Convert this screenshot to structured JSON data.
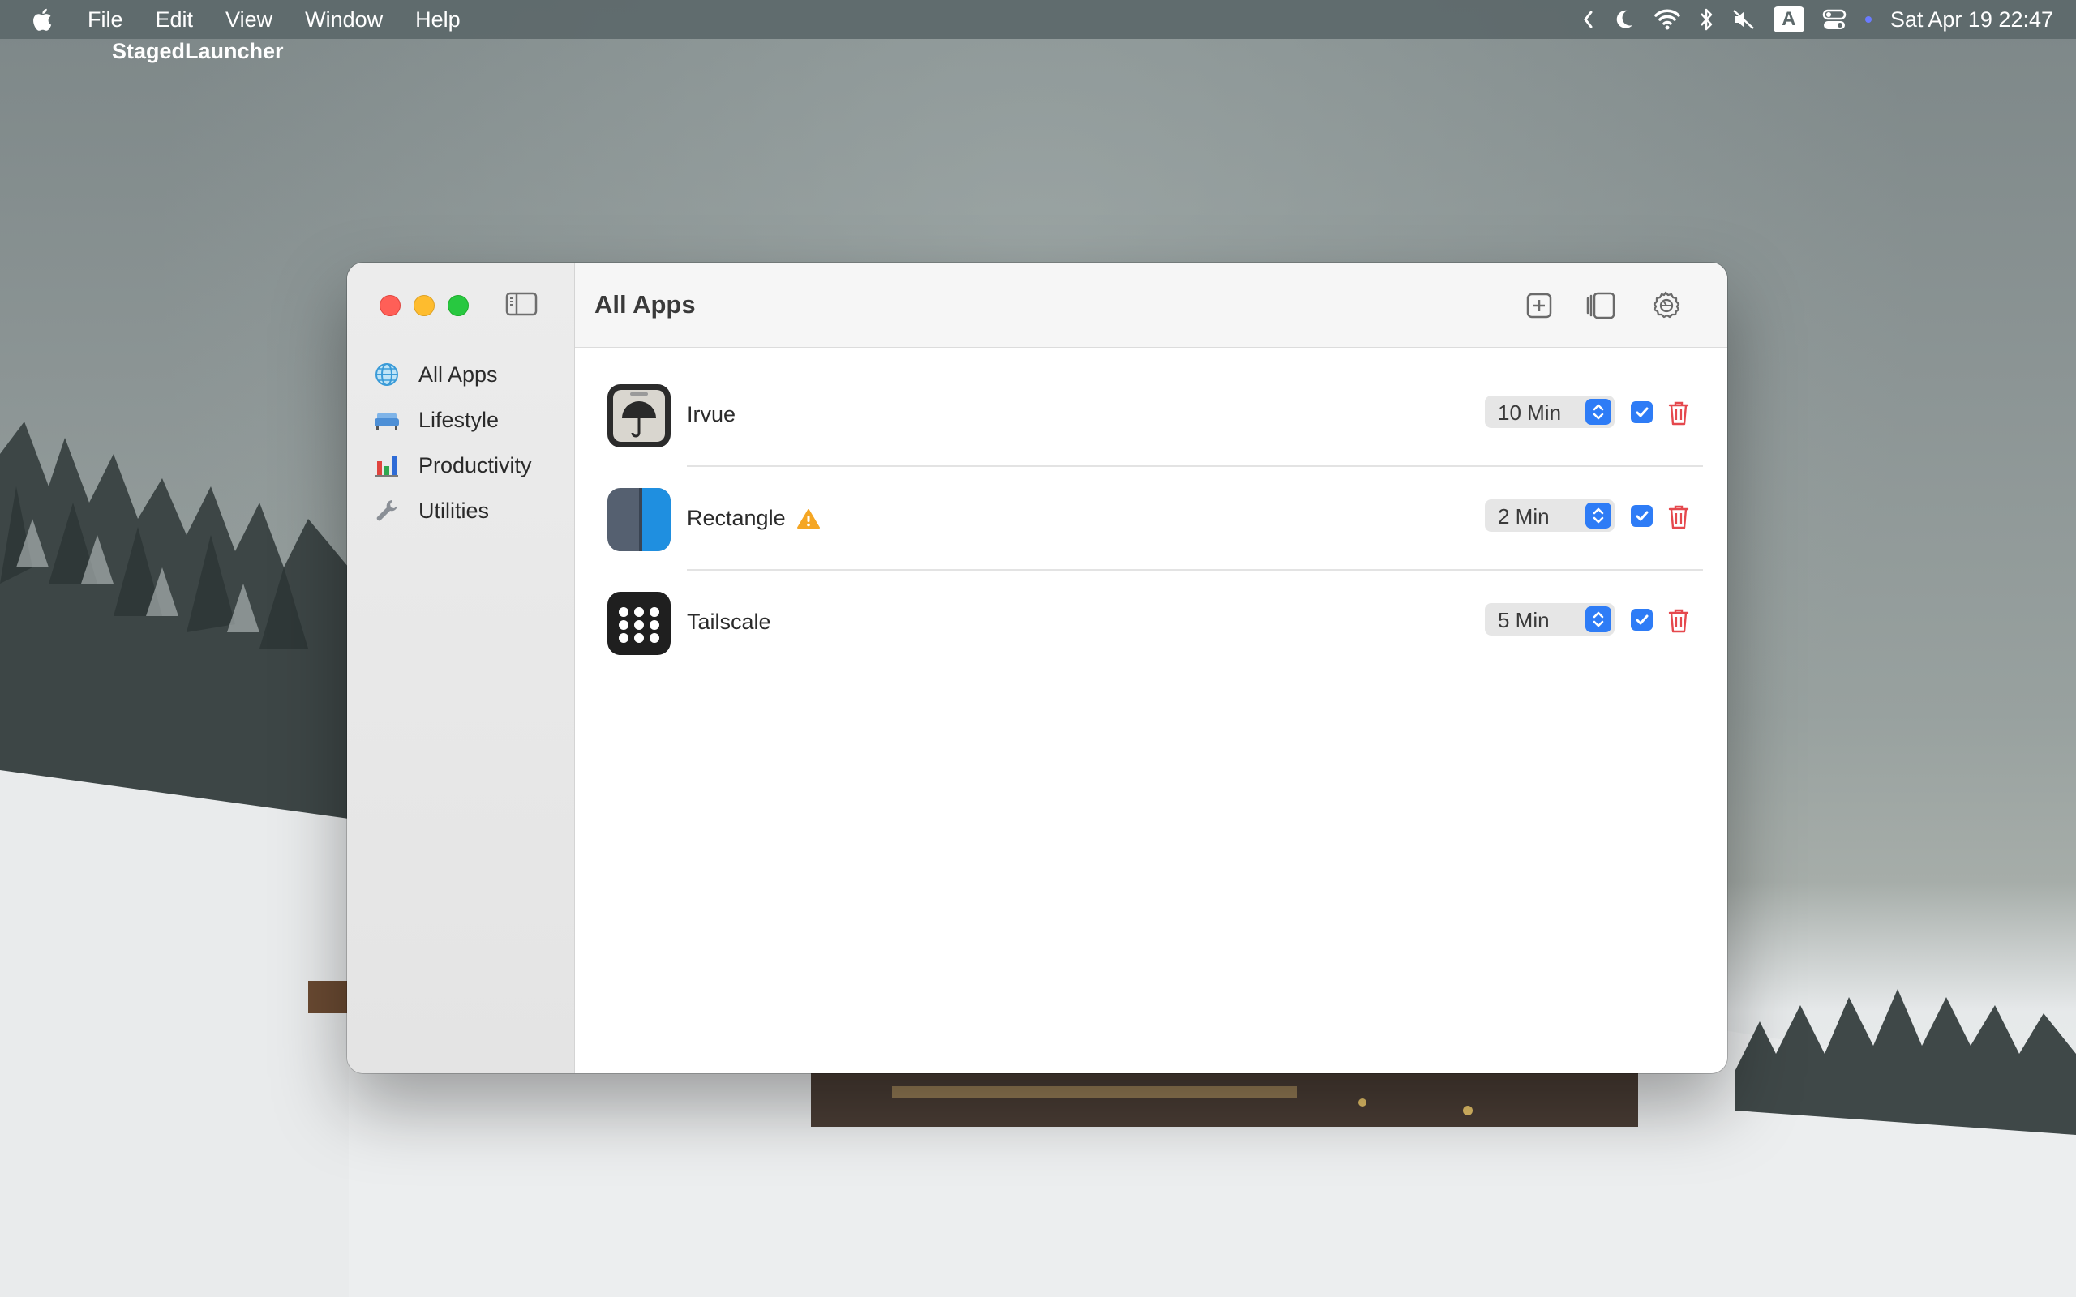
{
  "menubar": {
    "app_name": "StagedLauncher",
    "menus": [
      "File",
      "Edit",
      "View",
      "Window",
      "Help"
    ],
    "keyboard_badge": "A",
    "clock": "Sat Apr 19  22:47"
  },
  "window": {
    "title": "All Apps",
    "sidebar": {
      "items": [
        {
          "label": "All Apps",
          "icon": "globe-icon"
        },
        {
          "label": "Lifestyle",
          "icon": "sofa-icon"
        },
        {
          "label": "Productivity",
          "icon": "bar-chart-icon"
        },
        {
          "label": "Utilities",
          "icon": "wrench-icon"
        }
      ]
    },
    "toolbar": {
      "buttons": [
        "add-icon",
        "sidebar-right-icon",
        "settings-gear-icon"
      ]
    },
    "apps": [
      {
        "name": "Irvue",
        "delay": "10 Min",
        "enabled": true,
        "warning": false
      },
      {
        "name": "Rectangle",
        "delay": "2 Min",
        "enabled": true,
        "warning": true
      },
      {
        "name": "Tailscale",
        "delay": "5 Min",
        "enabled": true,
        "warning": false
      }
    ]
  },
  "colors": {
    "accent": "#2e7cf6",
    "delete": "#e5484d",
    "warning": "#f5a623"
  }
}
